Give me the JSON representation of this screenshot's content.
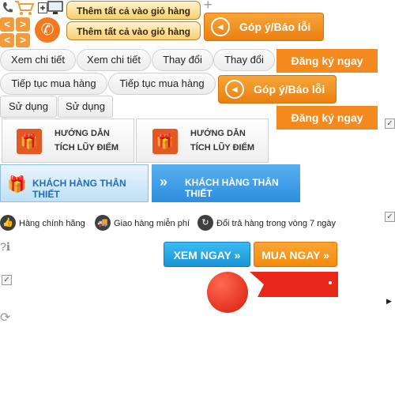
{
  "top_icons": {
    "phone_small": "phone-icon",
    "cart": "cart-icon",
    "grid": "grid-plus-icon",
    "monitor": "monitor-icon",
    "plus": "+",
    "arrows": [
      "<",
      ">",
      "<",
      ">"
    ],
    "phone_circle": "✆"
  },
  "cart_buttons": [
    "Thêm tất cả vào giỏ hàng",
    "Thêm tất cả vào giỏ hàng"
  ],
  "feedback_buttons": [
    "Góp ý/Báo lỗi",
    "Góp ý/Báo lỗi"
  ],
  "register_buttons": [
    "Đăng ký ngay",
    "Đăng ký ngay"
  ],
  "row_view": [
    "Xem chi tiết",
    "Xem chi tiết",
    "Thay đổi",
    "Thay đổi"
  ],
  "row_continue": [
    "Tiếp tục mua hàng",
    "Tiếp tục mua hàng"
  ],
  "row_use": [
    "Sử dụng",
    "Sử dụng"
  ],
  "guides": [
    {
      "line1": "HƯỚNG DẪN",
      "line2": "TÍCH LŨY ĐIỂM"
    },
    {
      "line1": "HƯỚNG DẪN",
      "line2": "TÍCH LŨY ĐIỂM"
    }
  ],
  "loyal_banners": [
    "KHÁCH HÀNG THÂN THIẾT",
    "KHÁCH HÀNG THÂN THIẾT"
  ],
  "features": [
    {
      "icon": "thumbs-up-icon",
      "text": "Hàng chính hãng"
    },
    {
      "icon": "delivery-truck-icon",
      "text": "Giao hàng miễn phí"
    },
    {
      "icon": "return-arrows-icon",
      "text": "Đổi trả hàng trong vòng 7 ngày"
    }
  ],
  "cta": {
    "view_now": "XEM NGAY »",
    "buy_now": "MUA NGAY »"
  },
  "colors": {
    "orange": "#f48a1e",
    "cream": "#f6cf73",
    "blue": "#2aa7e8",
    "red": "#e8261a",
    "buy_orange": "#f79a1a"
  }
}
